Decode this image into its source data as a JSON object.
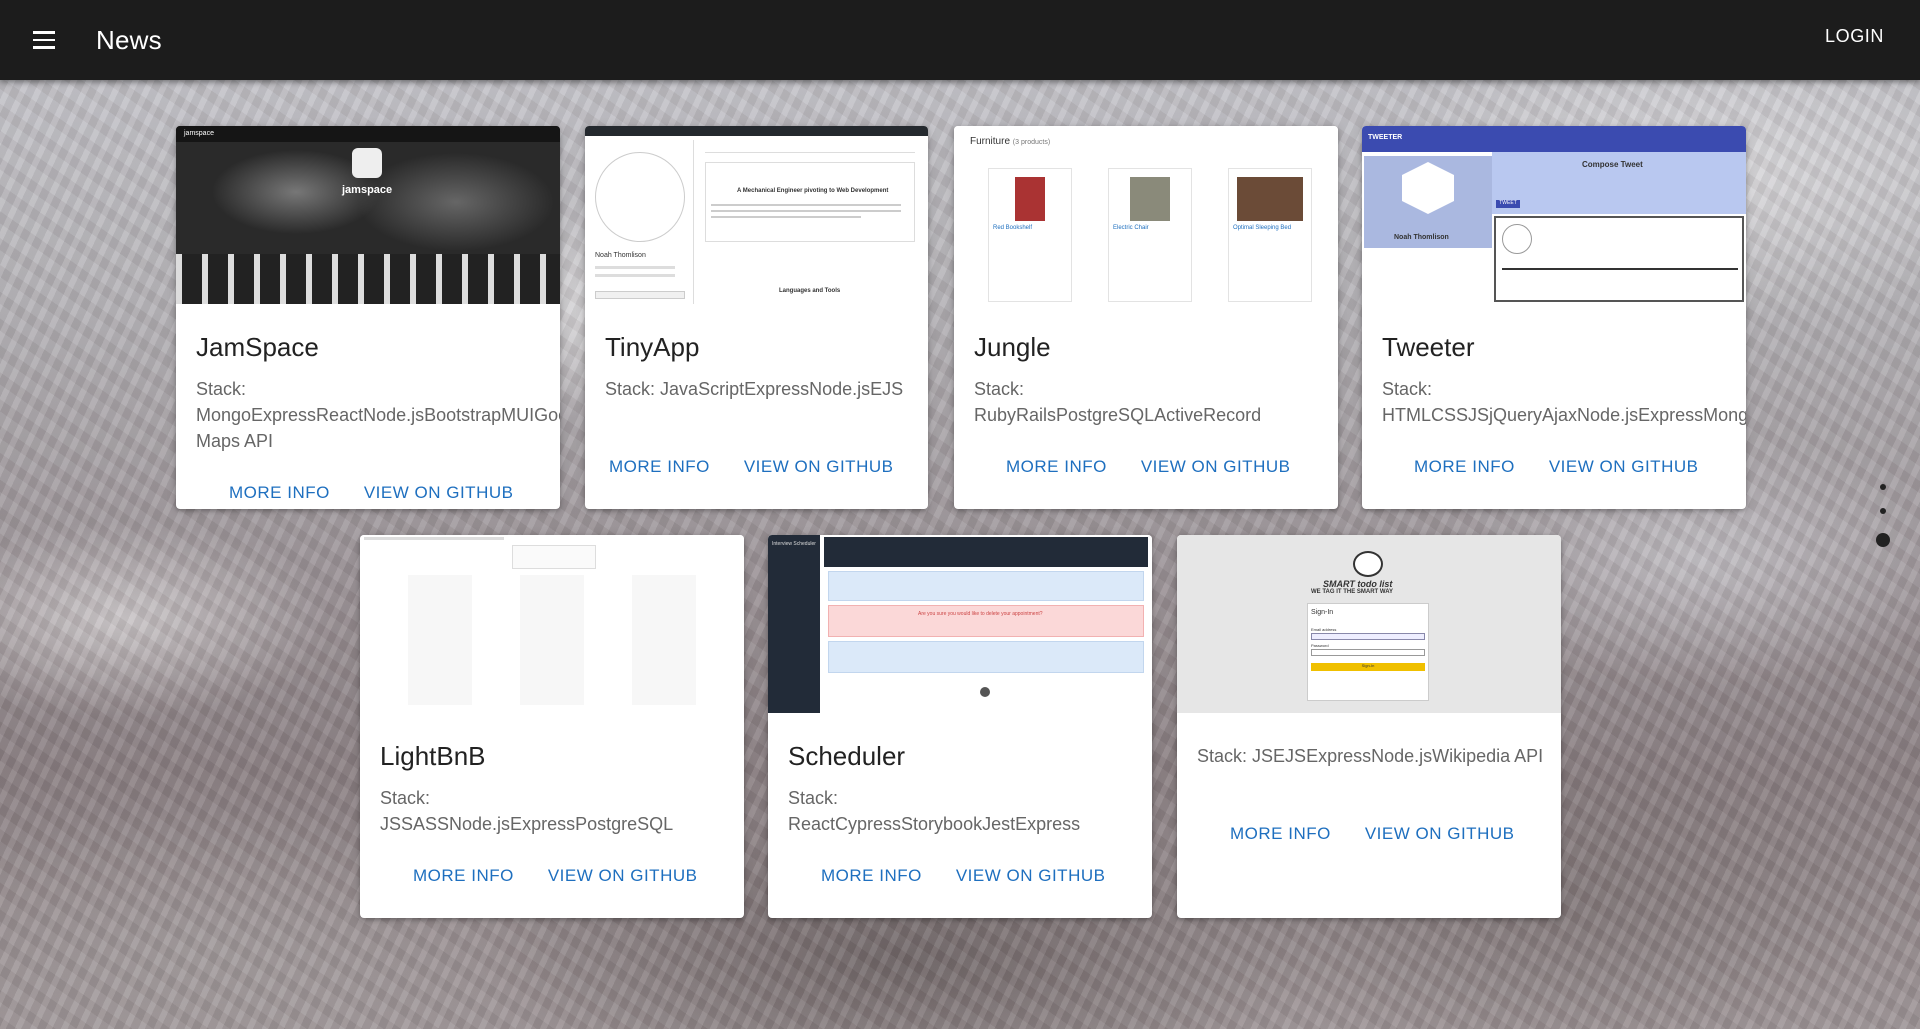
{
  "appbar": {
    "title": "News",
    "login_label": "LOGIN"
  },
  "cards": [
    {
      "title": "JamSpace",
      "stack_label": "Stack:",
      "stack_value": "MongoExpressReactNode.jsBootstrapMUIGoogle Maps API",
      "more_info": "MORE INFO",
      "github": "VIEW ON GITHUB",
      "preview": {
        "brand": "jamspace",
        "logo_text": "jamspace"
      }
    },
    {
      "title": "TinyApp",
      "stack_label": "Stack:",
      "stack_value": "JavaScriptExpressNode.jsEJS",
      "more_info": "MORE INFO",
      "github": "VIEW ON GITHUB",
      "preview": {
        "name": "Noah Thomlison",
        "heading": "A Mechanical Engineer pivoting to Web Development",
        "section": "Languages and Tools"
      }
    },
    {
      "title": "Jungle",
      "stack_label": "Stack:",
      "stack_value": "RubyRailsPostgreSQLActiveRecord",
      "more_info": "MORE INFO",
      "github": "VIEW ON GITHUB",
      "preview": {
        "header": "Furniture",
        "count": "(3 products)",
        "items": [
          "Red Bookshelf",
          "Electric Chair",
          "Optimal Sleeping Bed"
        ]
      }
    },
    {
      "title": "Tweeter",
      "stack_label": "Stack:",
      "stack_value": "HTMLCSSJSjQueryAjaxNode.jsExpressMongoDB",
      "more_info": "MORE INFO",
      "github": "VIEW ON GITHUB",
      "preview": {
        "brand": "TWEETER",
        "name": "Noah Thomlison",
        "compose": "Compose Tweet",
        "button": "TWEET"
      }
    },
    {
      "title": "LightBnB",
      "stack_label": "Stack:",
      "stack_value": "JSSASSNode.jsExpressPostgreSQL",
      "more_info": "MORE INFO",
      "github": "VIEW ON GITHUB",
      "preview": {}
    },
    {
      "title": "Scheduler",
      "stack_label": "Stack:",
      "stack_value": "ReactCypressStorybookJestExpress",
      "more_info": "MORE INFO",
      "github": "VIEW ON GITHUB",
      "preview": {
        "brand": "Interview Scheduler",
        "confirm": "Are you sure you would like to delete your appointment?"
      }
    },
    {
      "title": "",
      "stack_label": "Stack:",
      "stack_value": "JSEJSExpressNode.jsWikipedia API",
      "more_info": "MORE INFO",
      "github": "VIEW ON GITHUB",
      "preview": {
        "logo_line1": "SMART todo list",
        "logo_line2": "WE TAG IT THE SMART WAY",
        "signin": "Sign-In",
        "email": "Email address",
        "password": "Password",
        "button": "Sign-In"
      }
    }
  ],
  "pagination": {
    "dots": 3,
    "active_index": 2
  },
  "colors": {
    "appbar": "#1c1c1c",
    "action": "#1e6fbf",
    "card": "#ffffff"
  }
}
